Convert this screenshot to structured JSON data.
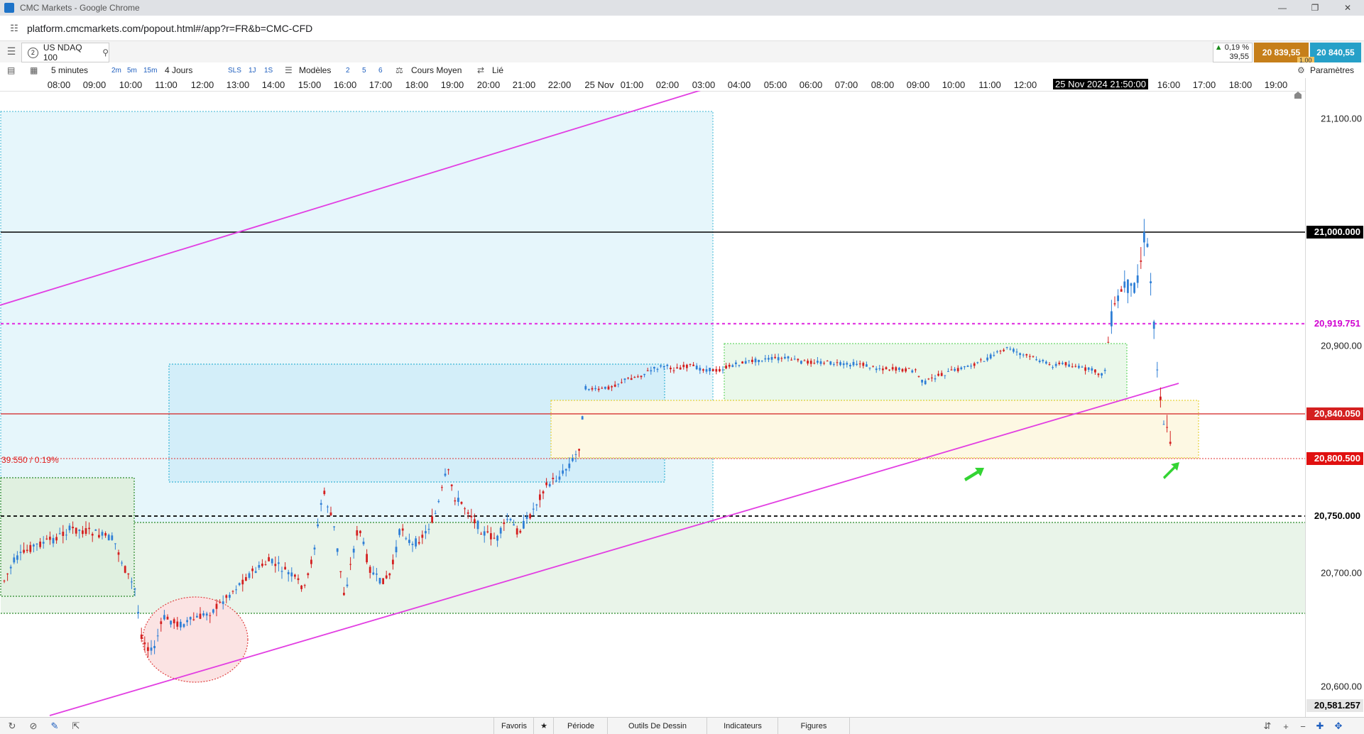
{
  "window": {
    "title": "CMC Markets - Google Chrome"
  },
  "browser": {
    "url": "platform.cmcmarkets.com/popout.html#/app?r=FR&b=CMC-CFD"
  },
  "instrument": {
    "tab_number": "2",
    "name": "US NDAQ 100",
    "change_pct": "0,19 %",
    "change_abs": "39,55",
    "sell_price": "20 839,55",
    "buy_price": "20 840,55",
    "spread": "1,00"
  },
  "toolbar": {
    "interval": "5 minutes",
    "tf_2m": "2m",
    "tf_5m": "5m",
    "tf_15m": "15m",
    "range": "4 Jours",
    "tf_sls": "SLS",
    "tf_1j": "1J",
    "tf_1s": "1S",
    "templates": "Modèles",
    "q2": "2",
    "q5": "5",
    "q6": "6",
    "price_type": "Cours Moyen",
    "linked": "Lié",
    "settings": "Paramètres"
  },
  "time_axis": {
    "labels": [
      "08:00",
      "09:00",
      "10:00",
      "11:00",
      "12:00",
      "13:00",
      "14:00",
      "15:00",
      "16:00",
      "17:00",
      "18:00",
      "19:00",
      "20:00",
      "21:00",
      "22:00",
      "25 Nov",
      "01:00",
      "02:00",
      "03:00",
      "04:00",
      "05:00",
      "06:00",
      "07:00",
      "08:00",
      "09:00",
      "10:00",
      "11:00",
      "12:00",
      "16:00",
      "17:00",
      "18:00",
      "19:00"
    ],
    "cursor_label": "25 Nov 2024 21:50:00"
  },
  "price_axis": {
    "labels": [
      "21,100.00",
      "20,900.00",
      "20,700.00",
      "20,600.00"
    ],
    "tags": [
      {
        "text": "21,000.000",
        "bg": "#000000",
        "fg": "#ffffff",
        "price": 21000
      },
      {
        "text": "20,919.751",
        "bg": "#ffffff",
        "fg": "#d000d0",
        "price": 20919.751
      },
      {
        "text": "20,840.050",
        "bg": "#d42020",
        "fg": "#ffffff",
        "price": 20840.05
      },
      {
        "text": "20,800.500",
        "bg": "#e01010",
        "fg": "#ffffff",
        "price": 20800.5
      },
      {
        "text": "20,750.000",
        "bg": "#ffffff",
        "fg": "#000000",
        "price": 20750
      },
      {
        "text": "20,581.257",
        "bg": "#e6e6e6",
        "fg": "#000000",
        "price": 20581.257
      }
    ]
  },
  "chart": {
    "change_label": "39.550 / 0.19%",
    "colors": {
      "up": "#2f7fd6",
      "down": "#d42020",
      "channel": "#e23ee2"
    }
  },
  "bottom_bar": {
    "favorites": "Favoris",
    "period": "Période",
    "drawing_tools": "Outils De Dessin",
    "indicators": "Indicateurs",
    "figures": "Figures"
  }
}
